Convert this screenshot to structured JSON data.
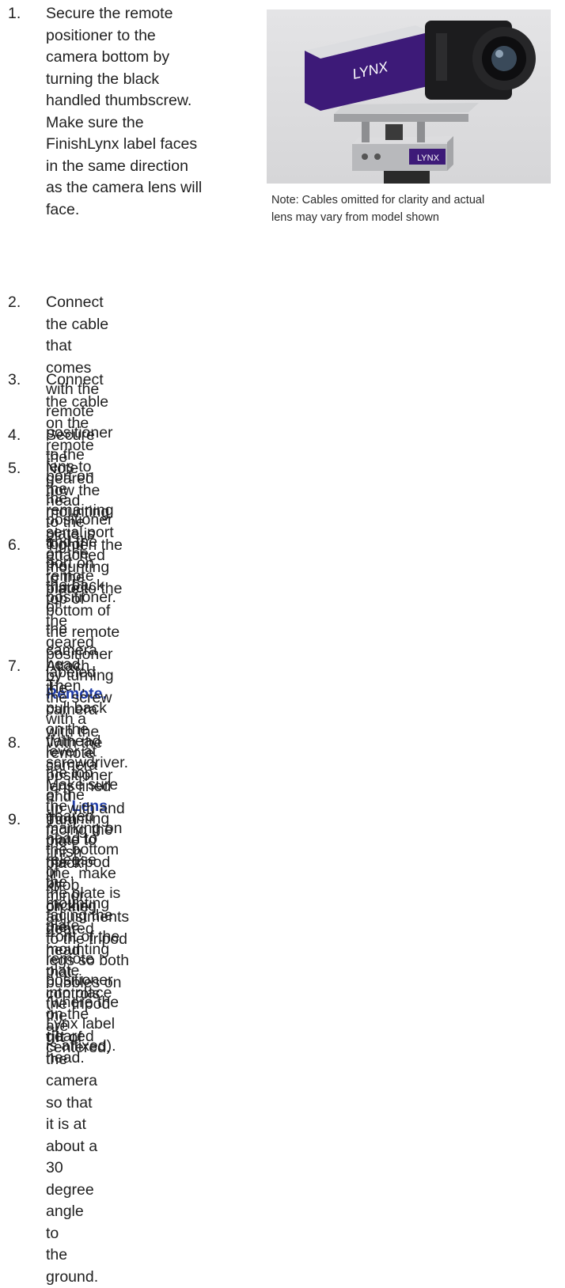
{
  "steps": [
    {
      "num": "1.",
      "lines": [
        "Secure the remote",
        "positioner to the",
        "camera bottom by",
        "turning the black",
        "handled thumbscrew.",
        "Make sure the",
        "FinishLynx label faces",
        "in the same direction",
        "as the camera lens will",
        "face."
      ]
    },
    {
      "num": "2.",
      "lines": [
        "Connect the cable that comes with the remote positioner",
        "to the port on the positioner and the port on the back of"
      ],
      "last_prefix": "the camera labeled ",
      "highlight": "Remote."
    },
    {
      "num": "3.",
      "lines": [
        "Connect the cable on the remote lens to the remaining",
        "serial port on the remote positioner."
      ]
    },
    {
      "num": "4.",
      "lines": [
        "Secure the geared head to the top of the tripod."
      ]
    },
    {
      "num": "5.",
      "lines": [
        "Note how the mounting plate is attached to the top of the",
        "geared head. Then, pull back on the lever at the top of the",
        "geared head to release the mounting plate."
      ]
    },
    {
      "num": "6.",
      "lines": [
        "Tighten the mounting plate to the bottom of the remote",
        "positioner by turning the screw with a flathead"
      ],
      "mid_prefix": "screwdriver. Make sure the ",
      "highlight": "Lens",
      "mid_suffix": " marking on the bottom of",
      "tail_lines": [
        "the plate is facing the front of the remote positioner",
        "(where the Lynx label is affixed)."
      ]
    },
    {
      "num": "7.",
      "lines": [
        "Attach the camera with the remote positioner and",
        "mounting plate to the tripod by clicking the mounting plate",
        "into place on the geared head."
      ]
    },
    {
      "num": "8.",
      "lines": [
        "With the camera lens lined up with and facing the finish",
        "line, make minor adjustments to the tripod legs so both",
        "bubbles on the tripod are centered."
      ]
    },
    {
      "num": "9.",
      "lines": [
        "Turn the black knob on the geared head that controls the"
      ],
      "bold_word": "tilt",
      "bold_suffix": " of the camera so that it is at about a 30 degree angle to",
      "tail_lines": [
        "the ground."
      ]
    }
  ],
  "photo": {
    "camera_brand_label": "LYNX",
    "positioner_label": "LYNX",
    "colors": {
      "brand_purple": "#3d1a78",
      "aluminum": "#c9cacc",
      "blue_text": "#1f3ca8"
    }
  },
  "note": {
    "line1": "Note: Cables omitted for clarity and actual",
    "line2": "lens may vary from model shown"
  }
}
